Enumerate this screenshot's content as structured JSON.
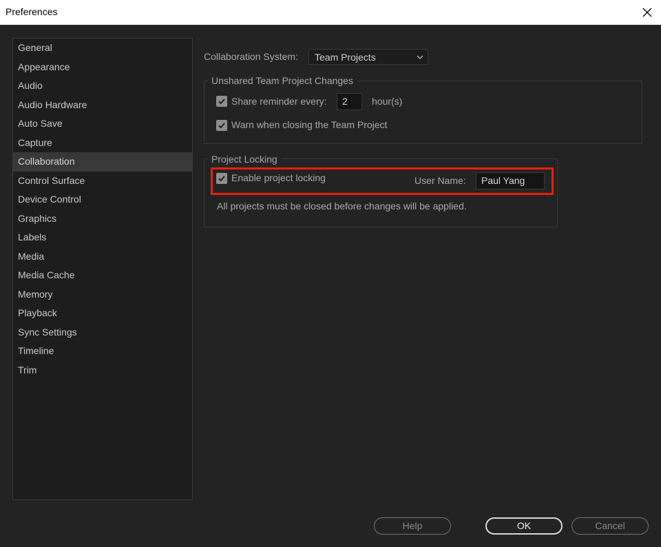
{
  "window": {
    "title": "Preferences",
    "close_icon": "close-icon"
  },
  "sidebar": {
    "selected": "Collaboration",
    "items": [
      {
        "label": "General"
      },
      {
        "label": "Appearance"
      },
      {
        "label": "Audio"
      },
      {
        "label": "Audio Hardware"
      },
      {
        "label": "Auto Save"
      },
      {
        "label": "Capture"
      },
      {
        "label": "Collaboration"
      },
      {
        "label": "Control Surface"
      },
      {
        "label": "Device Control"
      },
      {
        "label": "Graphics"
      },
      {
        "label": "Labels"
      },
      {
        "label": "Media"
      },
      {
        "label": "Media Cache"
      },
      {
        "label": "Memory"
      },
      {
        "label": "Playback"
      },
      {
        "label": "Sync Settings"
      },
      {
        "label": "Timeline"
      },
      {
        "label": "Trim"
      }
    ]
  },
  "collaboration": {
    "system_label": "Collaboration System:",
    "system_value": "Team Projects",
    "unshared": {
      "title": "Unshared Team Project Changes",
      "share_reminder_label": "Share reminder every:",
      "share_reminder_checked": true,
      "share_reminder_value": "2",
      "share_reminder_unit": "hour(s)",
      "warn_label": "Warn when closing the Team Project",
      "warn_checked": true
    },
    "locking": {
      "title": "Project Locking",
      "enable_label": "Enable project locking",
      "enable_checked": true,
      "user_name_label": "User Name:",
      "user_name_value": "Paul Yang",
      "note": "All projects must be closed before changes will be applied."
    }
  },
  "buttons": {
    "help": "Help",
    "ok": "OK",
    "cancel": "Cancel"
  },
  "colors": {
    "background": "#232323",
    "panel": "#1d1d1d",
    "selected": "#383838",
    "highlight": "#e8200c",
    "checkbox": "#8e8e8e"
  }
}
